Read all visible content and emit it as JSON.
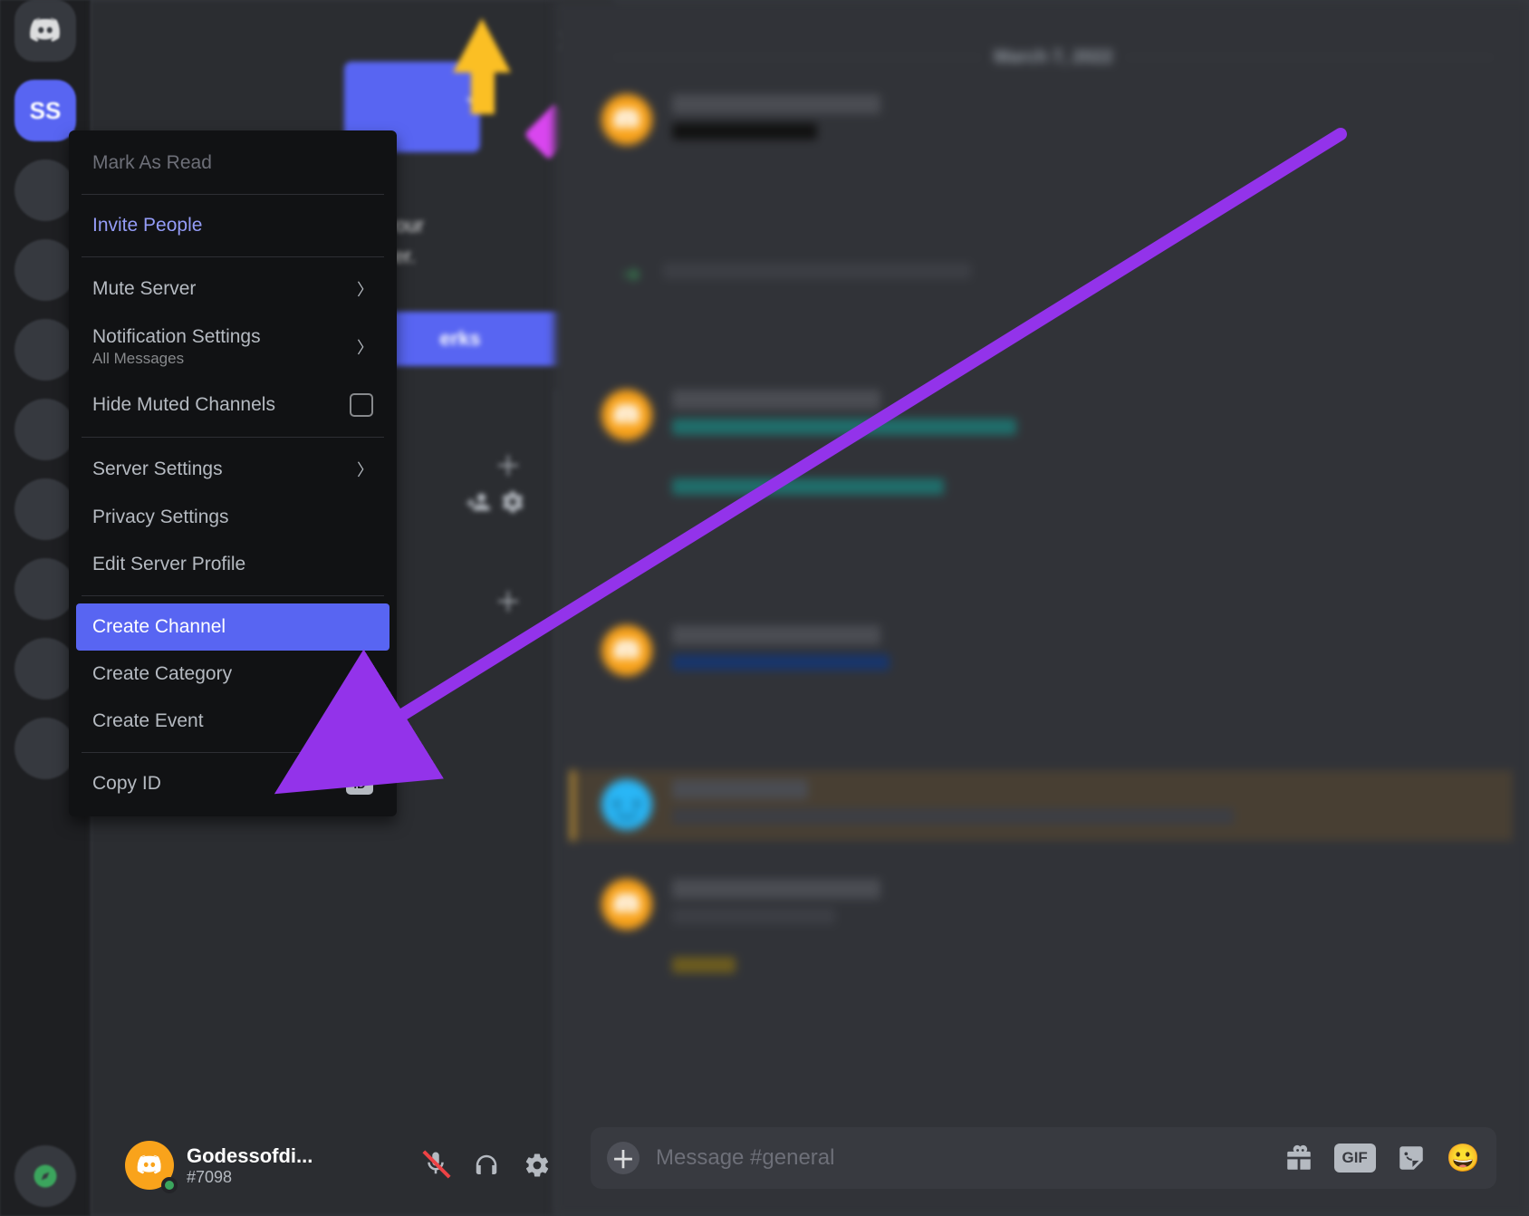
{
  "server_rail": {
    "active_server_badge": "SS"
  },
  "context_menu": {
    "mark_as_read": "Mark As Read",
    "invite_people": "Invite People",
    "mute_server": "Mute Server",
    "notification_settings": "Notification Settings",
    "notification_settings_sub": "All Messages",
    "hide_muted_channels": "Hide Muted Channels",
    "server_settings": "Server Settings",
    "privacy_settings": "Privacy Settings",
    "edit_server_profile": "Edit Server Profile",
    "create_channel": "Create Channel",
    "create_category": "Create Category",
    "create_event": "Create Event",
    "copy_id": "Copy ID",
    "copy_id_badge": "ID"
  },
  "boost_card": {
    "text_suffix": "! Rally your\nur server.",
    "perks_button_suffix": "erks"
  },
  "chat": {
    "date_divider": "March 7, 2022"
  },
  "compose": {
    "placeholder": "Message #general",
    "gif_label": "GIF"
  },
  "user_panel": {
    "username": "Godessofdi...",
    "tag": "#7098"
  },
  "colors": {
    "accent": "#5865f2",
    "annotation_arrow": "#9333ea"
  }
}
